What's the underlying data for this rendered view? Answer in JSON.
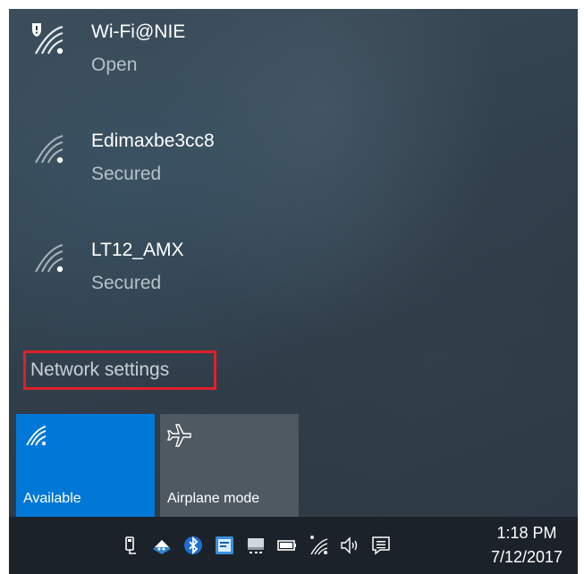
{
  "networks": [
    {
      "name": "Wi-Fi@NIE",
      "status": "Open",
      "icon": "wifi-open-shield-icon"
    },
    {
      "name": "Edimaxbe3cc8",
      "status": "Secured",
      "icon": "wifi-secured-icon"
    },
    {
      "name": "LT12_AMX",
      "status": "Secured",
      "icon": "wifi-secured-icon"
    }
  ],
  "settings_link": {
    "label": "Network settings",
    "highlight_color": "#e0202b"
  },
  "quick_actions": [
    {
      "label": "Available",
      "icon": "wifi-icon",
      "color": "#0078d7"
    },
    {
      "label": "Airplane mode",
      "icon": "airplane-icon",
      "color": "#4e5962"
    }
  ],
  "taskbar": {
    "tray_icons": [
      "usb-icon",
      "network-sync-icon",
      "bluetooth-icon",
      "app-icon",
      "display-icon",
      "battery-icon",
      "wifi-icon",
      "volume-icon",
      "notification-icon"
    ],
    "time": "1:18 PM",
    "date": "7/12/2017"
  }
}
